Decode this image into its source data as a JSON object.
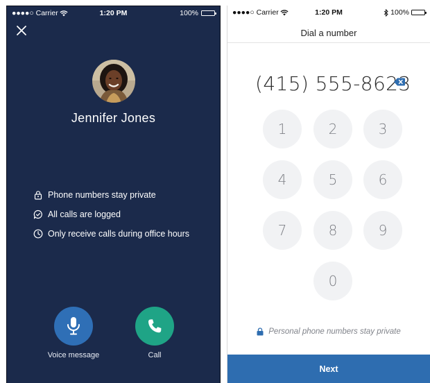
{
  "left_screen": {
    "status_bar": {
      "carrier": "●●●●○ Carrier",
      "time": "1:20 PM",
      "battery": "100%"
    },
    "contact": {
      "name": "Jennifer Jones"
    },
    "features": [
      {
        "icon": "lock-icon",
        "text": "Phone numbers stay private"
      },
      {
        "icon": "chat-check-icon",
        "text": "All calls are logged"
      },
      {
        "icon": "clock-icon",
        "text": "Only receive calls during office hours"
      }
    ],
    "actions": {
      "voice_message": {
        "label": "Voice message",
        "color": "#2f6fb6",
        "icon": "microphone-icon"
      },
      "call": {
        "label": "Call",
        "color": "#1fa486",
        "icon": "phone-icon"
      }
    },
    "background_color": "#1b2a4b"
  },
  "right_screen": {
    "status_bar": {
      "carrier": "●●●●○ Carrier",
      "time": "1:20 PM",
      "battery": "100%"
    },
    "title": "Dial a number",
    "phone_number": "(415) 555-8623",
    "keypad": [
      "1",
      "2",
      "3",
      "4",
      "5",
      "6",
      "7",
      "8",
      "9",
      "0"
    ],
    "privacy_note": "Personal phone numbers stay private",
    "next_label": "Next",
    "accent_color": "#2e6db0"
  }
}
